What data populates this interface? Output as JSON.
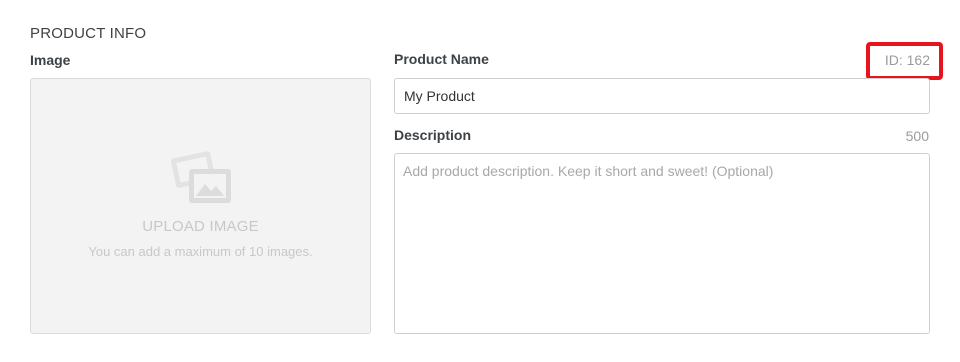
{
  "section": {
    "title": "PRODUCT INFO"
  },
  "image": {
    "label": "Image",
    "upload_title": "UPLOAD IMAGE",
    "upload_hint": "You can add a maximum of 10 images.",
    "icon": "image-upload-icon"
  },
  "product_name": {
    "label": "Product Name",
    "value": "My Product",
    "id_text": "ID: 162"
  },
  "description": {
    "label": "Description",
    "counter": "500",
    "placeholder": "Add product description. Keep it short and sweet! (Optional)",
    "value": ""
  },
  "colors": {
    "highlight": "#e8141d",
    "muted_text": "#9b9b9b",
    "upload_bg": "#f3f3f3"
  }
}
